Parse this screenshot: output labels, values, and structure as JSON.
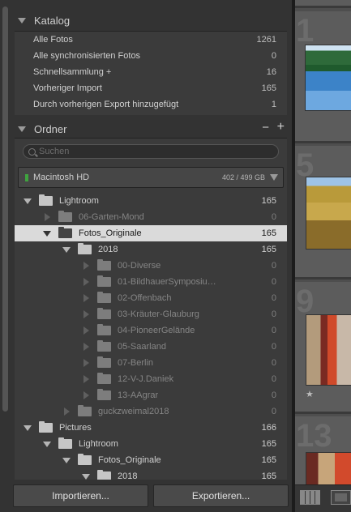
{
  "left_panel": {
    "katalog": {
      "title": "Katalog",
      "items": [
        {
          "label": "Alle Fotos",
          "count": "1261"
        },
        {
          "label": "Alle synchronisierten Fotos",
          "count": "0"
        },
        {
          "label": "Schnellsammlung  +",
          "count": "16"
        },
        {
          "label": "Vorheriger Import",
          "count": "165"
        },
        {
          "label": "Durch vorherigen Export hinzugefügt",
          "count": "1"
        }
      ]
    },
    "ordner": {
      "title": "Ordner",
      "minus_icon": "−",
      "plus_icon": "+",
      "search_placeholder": "Suchen",
      "volume": {
        "name": "Macintosh HD",
        "size": "402 / 499 GB",
        "status_color": "#3fa33f"
      },
      "folders": [
        {
          "name": "Lightroom",
          "count": "165",
          "level": 0,
          "expander": "down",
          "dim": false,
          "selected": false
        },
        {
          "name": "06-Garten-Mond",
          "count": "0",
          "level": 1,
          "expander": "right",
          "dim": true,
          "selected": false
        },
        {
          "name": "Fotos_Originale",
          "count": "165",
          "level": 1,
          "expander": "down",
          "dim": false,
          "selected": true
        },
        {
          "name": "2018",
          "count": "165",
          "level": 2,
          "expander": "down",
          "dim": false,
          "selected": false
        },
        {
          "name": "00-Diverse",
          "count": "0",
          "level": 3,
          "expander": "right",
          "dim": true,
          "selected": false
        },
        {
          "name": "01-BildhauerSymposiu…",
          "count": "0",
          "level": 3,
          "expander": "right",
          "dim": true,
          "selected": false
        },
        {
          "name": "02-Offenbach",
          "count": "0",
          "level": 3,
          "expander": "right",
          "dim": true,
          "selected": false
        },
        {
          "name": "03-Kräuter-Glauburg",
          "count": "0",
          "level": 3,
          "expander": "right",
          "dim": true,
          "selected": false
        },
        {
          "name": "04-PioneerGelände",
          "count": "0",
          "level": 3,
          "expander": "right",
          "dim": true,
          "selected": false
        },
        {
          "name": "05-Saarland",
          "count": "0",
          "level": 3,
          "expander": "right",
          "dim": true,
          "selected": false
        },
        {
          "name": "07-Berlin",
          "count": "0",
          "level": 3,
          "expander": "right",
          "dim": true,
          "selected": false
        },
        {
          "name": "12-V-J.Daniek",
          "count": "0",
          "level": 3,
          "expander": "right",
          "dim": true,
          "selected": false
        },
        {
          "name": "13-AAgrar",
          "count": "0",
          "level": 3,
          "expander": "right",
          "dim": true,
          "selected": false
        },
        {
          "name": "guckzweimal2018",
          "count": "0",
          "level": 2,
          "expander": "right",
          "dim": true,
          "selected": false
        },
        {
          "name": "Pictures",
          "count": "166",
          "level": 0,
          "expander": "down",
          "dim": false,
          "selected": false
        },
        {
          "name": "Lightroom",
          "count": "165",
          "level": 1,
          "expander": "down",
          "dim": false,
          "selected": false
        },
        {
          "name": "Fotos_Originale",
          "count": "165",
          "level": 2,
          "expander": "down",
          "dim": false,
          "selected": false
        },
        {
          "name": "2018",
          "count": "165",
          "level": 3,
          "expander": "down",
          "dim": false,
          "selected": false
        }
      ]
    },
    "buttons": {
      "import": "Importieren...",
      "export": "Exportieren..."
    }
  },
  "grid": {
    "cells": [
      {
        "number": "1",
        "thumb": "lake"
      },
      {
        "number": "5",
        "thumb": "field"
      },
      {
        "number": "9",
        "thumb": "people",
        "rating": "★"
      },
      {
        "number": "13",
        "thumb": "room"
      }
    ]
  },
  "colors": {
    "selection": "#dadada",
    "panel": "#3b3b3b",
    "background": "#333333"
  }
}
